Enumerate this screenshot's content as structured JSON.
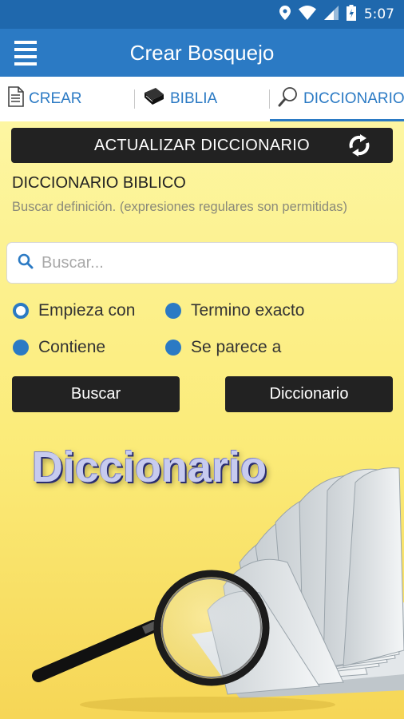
{
  "status_bar": {
    "time": "5:07"
  },
  "app_bar": {
    "title": "Crear Bosquejo"
  },
  "tabs": [
    {
      "label": "CREAR",
      "icon": "document-icon"
    },
    {
      "label": "BIBLIA",
      "icon": "bible-icon"
    },
    {
      "label": "DICCIONARIO",
      "icon": "magnifier-icon",
      "active": true
    }
  ],
  "update": {
    "label": "ACTUALIZAR DICCIONARIO",
    "icon": "refresh-icon"
  },
  "section": {
    "title": "DICCIONARIO BIBLICO",
    "subtitle": "Buscar definición. (expresiones regulares son permitidas)"
  },
  "search": {
    "placeholder": "Buscar...",
    "value": ""
  },
  "options": {
    "starts_with": "Empieza con",
    "exact_term": "Termino exacto",
    "contains": "Contiene",
    "similar_to": "Se parece a",
    "selected": "starts_with"
  },
  "buttons": {
    "search": "Buscar",
    "dictionary": "Diccionario"
  },
  "banner": {
    "title": "Diccionario"
  },
  "colors": {
    "status_bar": "#1f68ad",
    "app_bar": "#2b7ac4",
    "accent": "#2b7ac4",
    "button": "#222222"
  }
}
